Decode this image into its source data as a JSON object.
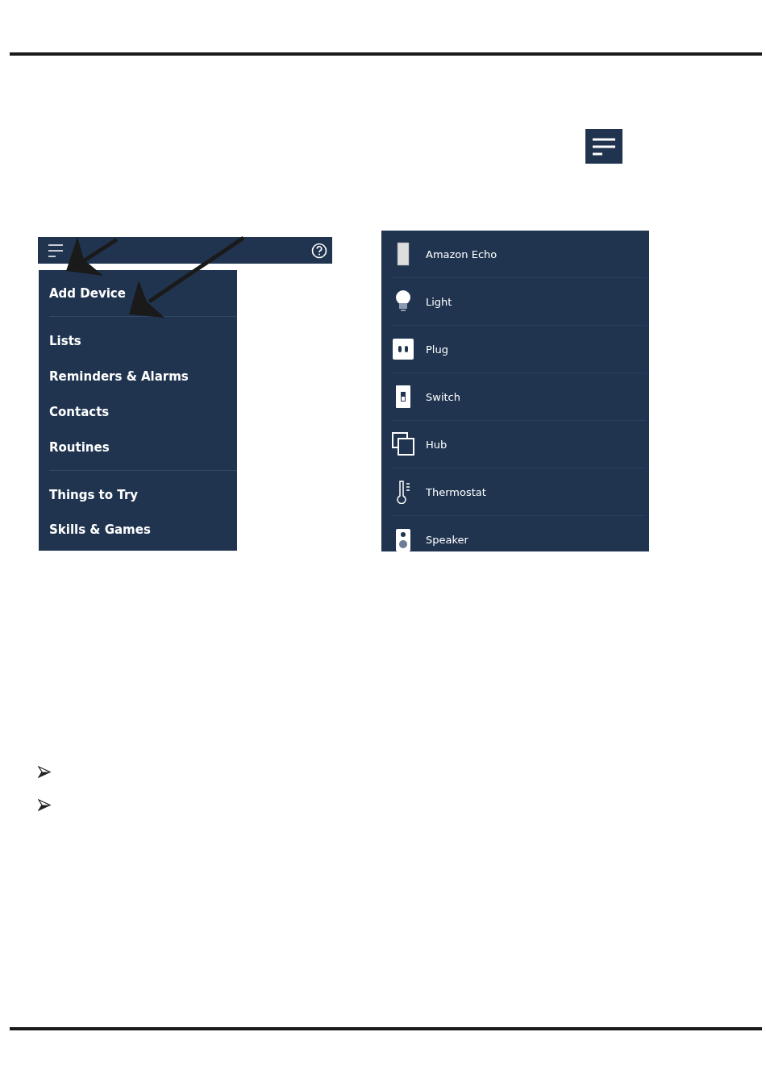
{
  "menu": {
    "sections": [
      [
        "Add Device"
      ],
      [
        "Lists",
        "Reminders & Alarms",
        "Contacts",
        "Routines"
      ],
      [
        "Things to Try",
        "Skills & Games"
      ]
    ]
  },
  "devices": [
    {
      "kind": "echo",
      "label": "Amazon Echo"
    },
    {
      "kind": "light",
      "label": "Light"
    },
    {
      "kind": "plug",
      "label": "Plug"
    },
    {
      "kind": "switch",
      "label": "Switch"
    },
    {
      "kind": "hub",
      "label": "Hub"
    },
    {
      "kind": "thermostat",
      "label": "Thermostat"
    },
    {
      "kind": "speaker",
      "label": "Speaker"
    }
  ]
}
